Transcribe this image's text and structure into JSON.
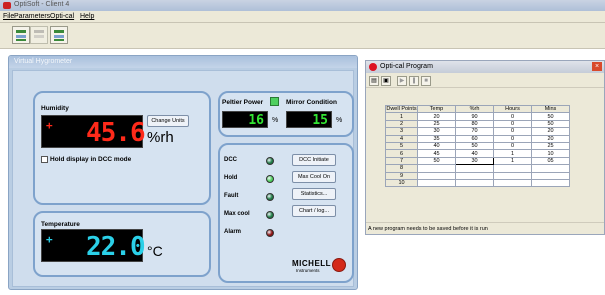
{
  "app": {
    "title": "OptiSoft - Client 4"
  },
  "menu": [
    "File",
    "Parameters",
    "Opti-cal",
    "Help"
  ],
  "hygrometer": {
    "window_title": "Virtual Hygrometer",
    "humidity": {
      "label": "Humidity",
      "value": "45.6",
      "sign": "+",
      "unit": "%rh",
      "change_units_label": "Change Units",
      "hold_label": "Hold display in DCC mode"
    },
    "temperature": {
      "label": "Temperature",
      "value": "22.0",
      "sign": "+",
      "unit": "°C"
    },
    "peltier": {
      "label": "Peltier Power",
      "value": "16",
      "unit": "%"
    },
    "mirror": {
      "label": "Mirror Condition",
      "value": "15",
      "unit": "%"
    },
    "indicators": [
      {
        "label": "DCC",
        "color": "#1e7a45"
      },
      {
        "label": "Hold",
        "color": "#4ccf5a"
      },
      {
        "label": "Fault",
        "color": "#1e7a45"
      },
      {
        "label": "Max cool",
        "color": "#1e7a45"
      },
      {
        "label": "Alarm",
        "color": "#8b1010"
      }
    ],
    "buttons": [
      "DCC Initiate",
      "Max Cool On",
      "Statistics...",
      "Chart / log..."
    ],
    "brand": {
      "name": "MICHELL",
      "sub": "Instruments"
    }
  },
  "opti_cal": {
    "window_title": "Opti-cal Program",
    "columns": [
      "Dwell Points",
      "Temp",
      "%rh",
      "Hours",
      "Mins"
    ],
    "rows": [
      [
        "1",
        "20",
        "90",
        "0",
        "50"
      ],
      [
        "2",
        "25",
        "80",
        "0",
        "50"
      ],
      [
        "3",
        "30",
        "70",
        "0",
        "20"
      ],
      [
        "4",
        "35",
        "60",
        "0",
        "20"
      ],
      [
        "5",
        "40",
        "50",
        "0",
        "25"
      ],
      [
        "6",
        "45",
        "40",
        "1",
        "10"
      ],
      [
        "7",
        "50",
        "30",
        "1",
        "05"
      ],
      [
        "8",
        "",
        "",
        "",
        ""
      ],
      [
        "9",
        "",
        "",
        "",
        ""
      ],
      [
        "10",
        "",
        "",
        "",
        ""
      ]
    ],
    "status": "A new program needs to be saved before it is run"
  }
}
